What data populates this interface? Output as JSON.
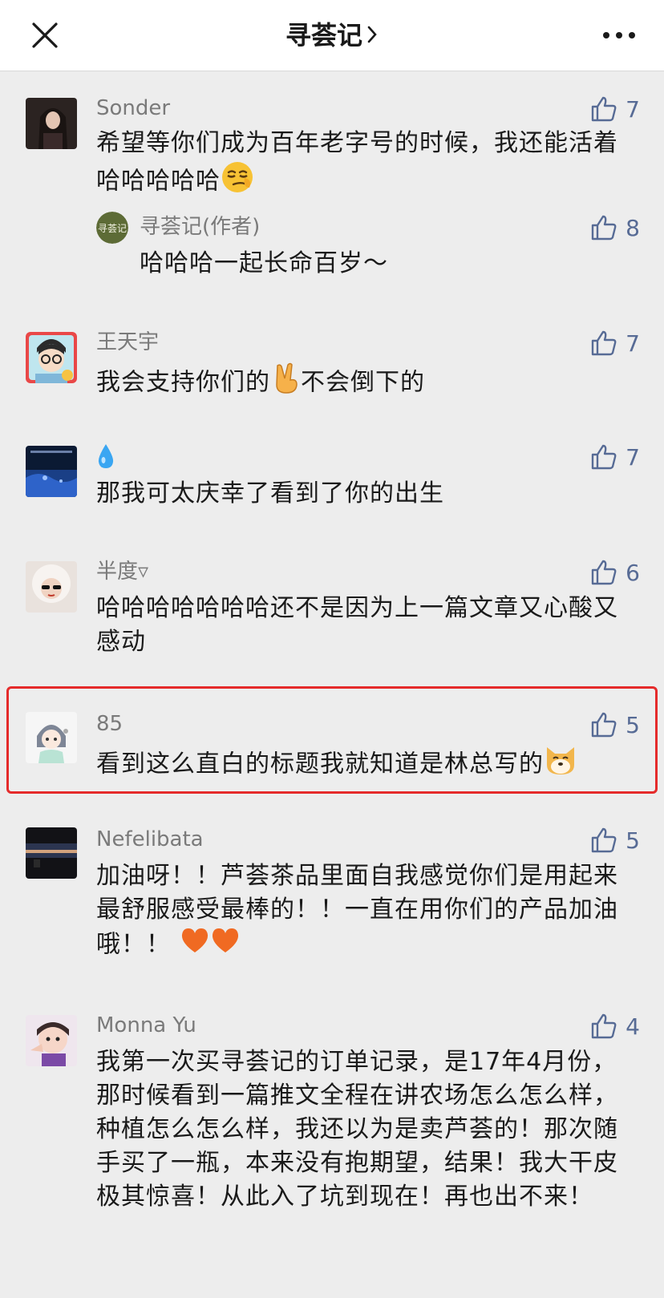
{
  "header": {
    "title": "寻荟记"
  },
  "comments": [
    {
      "name": "Sonder",
      "likes": "7",
      "text": "希望等你们成为百年老字号的时候，我还能活着哈哈哈哈哈",
      "reply": {
        "name": "寻荟记(作者)",
        "likes": "8",
        "text": "哈哈哈一起长命百岁～"
      }
    },
    {
      "name": "王天宇",
      "likes": "7",
      "text_a": "我会支持你们的",
      "text_b": "不会倒下的"
    },
    {
      "name": "💧",
      "likes": "7",
      "text": "那我可太庆幸了看到了你的出生"
    },
    {
      "name": "半度▿",
      "likes": "6",
      "text": "哈哈哈哈哈哈哈还不是因为上一篇文章又心酸又感动"
    },
    {
      "name": "85",
      "likes": "5",
      "text": "看到这么直白的标题我就知道是林总写的"
    },
    {
      "name": "Nefelibata",
      "likes": "5",
      "text": "加油呀！！芦荟茶品里面自我感觉你们是用起来最舒服感受最棒的！！一直在用你们的产品加油哦！！"
    },
    {
      "name": "Monna Yu",
      "likes": "4",
      "text": "我第一次买寻荟记的订单记录，是17年4月份，那时候看到一篇推文全程在讲农场怎么怎么样，种植怎么怎么样，我还以为是卖芦荟的！那次随手买了一瓶，本来没有抱期望，结果！我大干皮极其惊喜！从此入了坑到现在！再也出不来！"
    }
  ],
  "colors": {
    "accent": "#576b95",
    "highlight": "#e52b2b",
    "background": "#ededed"
  },
  "icons": [
    "close-icon",
    "chevron-right-icon",
    "more-icon",
    "thumbs-up-icon",
    "smirk-emoji",
    "victory-hand-emoji",
    "dog-face-emoji",
    "heart-emoji"
  ]
}
